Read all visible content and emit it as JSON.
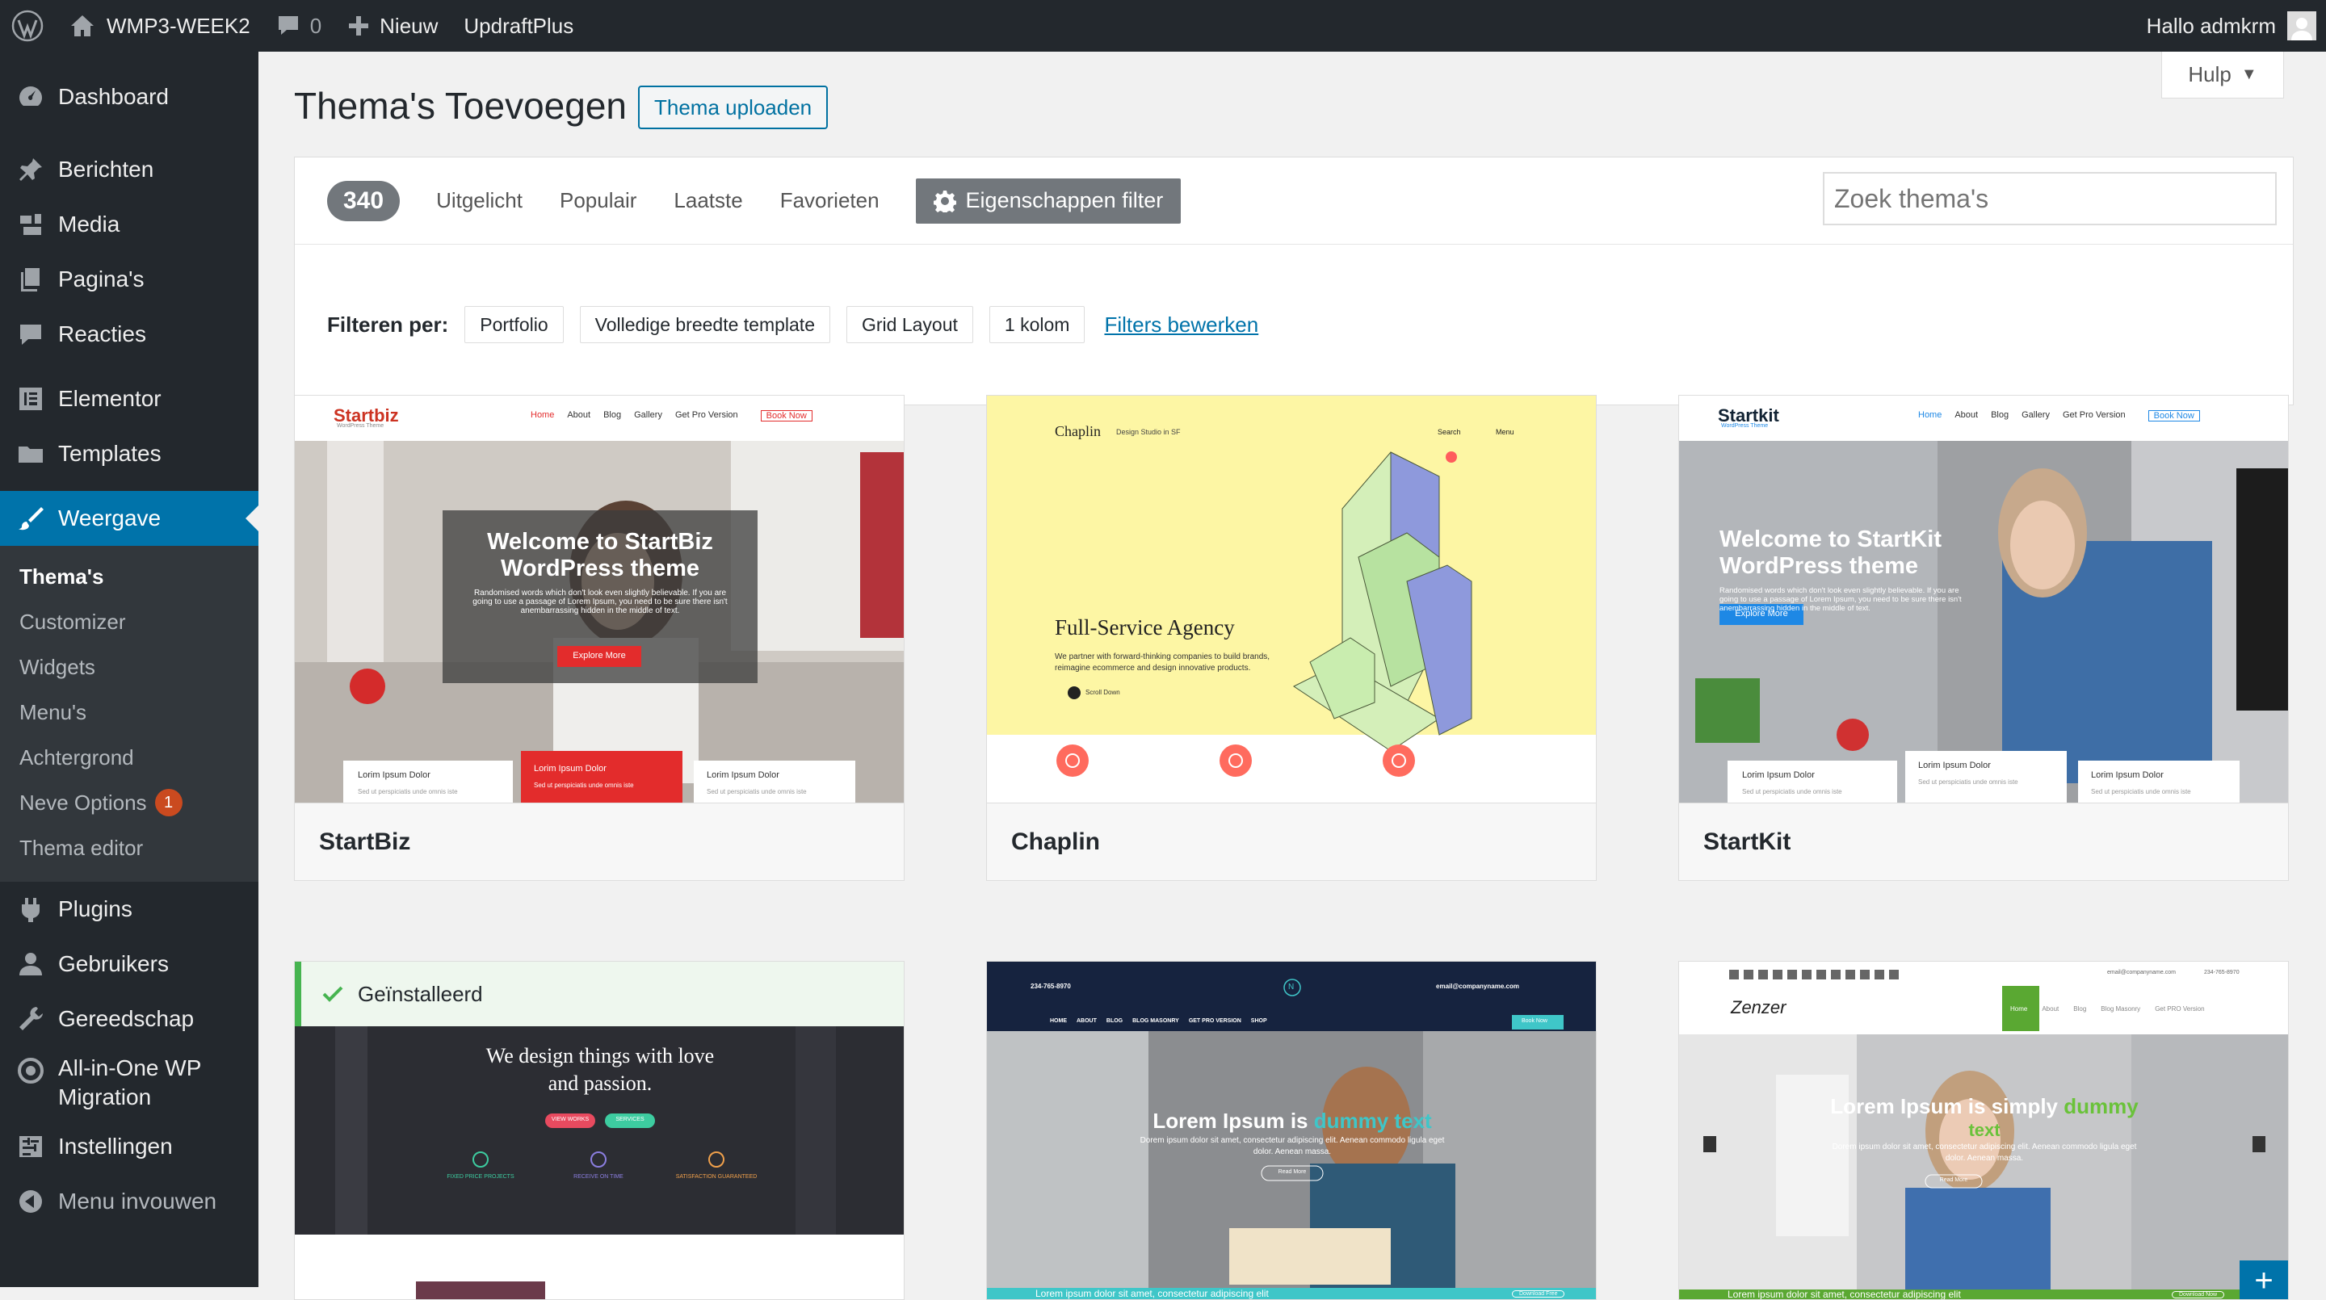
{
  "adminbar": {
    "site_name": "WMP3-WEEK2",
    "comments_count": "0",
    "new_label": "Nieuw",
    "plugin_label": "UpdraftPlus",
    "greeting": "Hallo admkrm"
  },
  "sidebar": {
    "items": [
      {
        "label": "Dashboard",
        "icon": "dashboard-icon"
      },
      {
        "label": "Berichten",
        "icon": "pin-icon"
      },
      {
        "label": "Media",
        "icon": "media-icon"
      },
      {
        "label": "Pagina's",
        "icon": "pages-icon"
      },
      {
        "label": "Reacties",
        "icon": "comments-icon"
      },
      {
        "label": "Elementor",
        "icon": "elementor-icon"
      },
      {
        "label": "Templates",
        "icon": "folder-icon"
      },
      {
        "label": "Weergave",
        "icon": "brush-icon"
      },
      {
        "label": "Plugins",
        "icon": "plugin-icon"
      },
      {
        "label": "Gebruikers",
        "icon": "users-icon"
      },
      {
        "label": "Gereedschap",
        "icon": "wrench-icon"
      },
      {
        "label": "All-in-One WP Migration",
        "icon": "migration-icon"
      },
      {
        "label": "Instellingen",
        "icon": "settings-icon"
      },
      {
        "label": "Menu invouwen",
        "icon": "collapse-icon"
      }
    ],
    "submenu": [
      "Thema's",
      "Customizer",
      "Widgets",
      "Menu's",
      "Achtergrond",
      "Neve Options",
      "Thema editor"
    ],
    "neve_badge": "1"
  },
  "help_label": "Hulp",
  "page_title": "Thema's Toevoegen",
  "upload_label": "Thema uploaden",
  "filter": {
    "count": "340",
    "tabs": [
      "Uitgelicht",
      "Populair",
      "Laatste",
      "Favorieten"
    ],
    "feature_filter_label": "Eigenschappen filter",
    "search_placeholder": "Zoek thema's",
    "filter_by_label": "Filteren per:",
    "chips": [
      "Portfolio",
      "Volledige breedte template",
      "Grid Layout",
      "1 kolom"
    ],
    "edit_filters_label": "Filters bewerken"
  },
  "themes": [
    {
      "name": "StartBiz",
      "preview": {
        "logo": "Startbiz",
        "logo_sub": "WordPress Theme",
        "nav": [
          "Home",
          "About",
          "Blog",
          "Gallery",
          "Get Pro Version",
          "Book Now"
        ],
        "heading": [
          "Welcome to StartBiz",
          "WordPress theme"
        ],
        "text": [
          "Randomised words which don't look even slightly believable. If you are",
          "going to use a passage of Lorem Ipsum, you need to be sure there isn't",
          "anembarrassing hidden in the middle of text."
        ],
        "button": "Explore More",
        "features": [
          "Lorim Ipsum Dolor",
          "Lorim Ipsum Dolor",
          "Lorim Ipsum Dolor"
        ],
        "feature_sub": [
          "Sed ut perspiciatis unde omnis iste",
          "Sed ut perspiciatis unde omnis iste",
          "Sed ut perspiciatis unde omnis iste"
        ]
      }
    },
    {
      "name": "Chaplin",
      "preview": {
        "logo": "Chaplin",
        "tagline": "Design Studio in SF",
        "search": "Search",
        "menu": "Menu",
        "heading": "Full-Service Agency",
        "text": [
          "We partner with forward-thinking companies to build brands,",
          "reimagine ecommerce and design innovative products."
        ],
        "scroll": "Scroll Down"
      }
    },
    {
      "name": "StartKit",
      "preview": {
        "logo": "Startkit",
        "logo_sub": "WordPress Theme",
        "nav": [
          "Home",
          "About",
          "Blog",
          "Gallery",
          "Get Pro Version",
          "Book Now"
        ],
        "heading": [
          "Welcome to StartKit",
          "WordPress theme"
        ],
        "text": [
          "Randomised words which don't look even slightly believable. If you are",
          "going to use a passage of Lorem Ipsum, you need to be sure there isn't",
          "anembarrassing hidden in the middle of text."
        ],
        "button": "Explore More",
        "features": [
          "Lorim Ipsum Dolor",
          "Lorim Ipsum Dolor",
          "Lorim Ipsum Dolor"
        ],
        "feature_sub": [
          "Sed ut perspiciatis unde omnis iste",
          "Sed ut perspiciatis unde omnis iste",
          "Sed ut perspiciatis unde omnis iste"
        ]
      }
    },
    {
      "installed_label": "Geïnstalleerd",
      "preview": {
        "heading": [
          "We design things with love",
          "and passion."
        ],
        "btn1": "VIEW WORKS",
        "btn2": "SERVICES",
        "features": [
          "FIXED PRICE PROJECTS",
          "RECEIVE ON TIME",
          "SATISFACTION GUARANTEED"
        ]
      }
    },
    {
      "preview": {
        "phone": "234-765-8970",
        "logo": "N",
        "email": "email@companyname.com",
        "nav": [
          "HOME",
          "ABOUT",
          "BLOG",
          "BLOG MASONRY",
          "GET PRO VERSION",
          "SHOP"
        ],
        "book": "Book Now",
        "heading_a": "Lorem Ipsum is ",
        "heading_b": "dummy text",
        "text": [
          "Dorem ipsum dolor sit amet, consectetur adipiscing elit. Aenean commodo ligula eget",
          "dolor. Aenean massa."
        ],
        "button": "Read More",
        "footer": "Lorem ipsum dolor sit amet, consectetur adipiscing elit",
        "download": "Download Free"
      }
    },
    {
      "preview": {
        "email": "email@companyname.com",
        "phone": "234-765-8970",
        "logo": "Zenzer",
        "nav": [
          "Home",
          "About",
          "Blog",
          "Blog Masonry",
          "Get PRO Version"
        ],
        "heading_a": "Lorem Ipsum is simply ",
        "heading_b": "dummy",
        "heading_c": "text",
        "text": [
          "Dorem ipsum dolor sit amet, consectetur adipiscing elit. Aenean commodo ligula eget",
          "dolor. Aenean massa."
        ],
        "button": "Read More",
        "footer": "Lorem ipsum dolor sit amet, consectetur adipiscing elit",
        "download": "Download Now"
      }
    }
  ],
  "colors": {
    "adminbar": "#23282d",
    "accent": "#0073aa",
    "badge": "#ca4a1f",
    "installed": "#46b450"
  }
}
